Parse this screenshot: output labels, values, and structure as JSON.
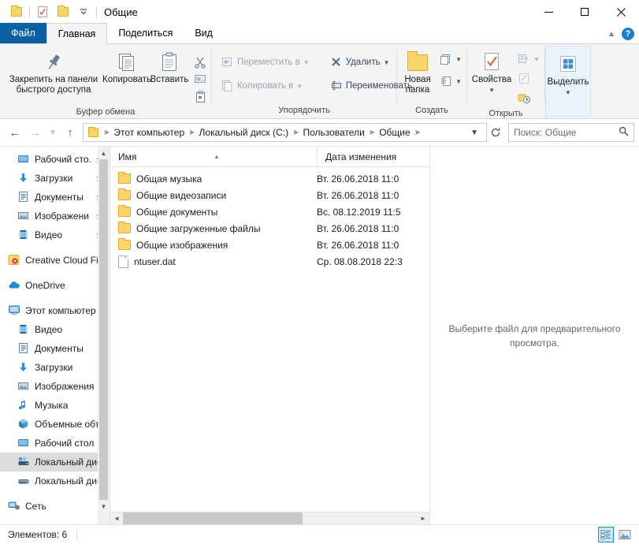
{
  "window": {
    "title": "Общие",
    "quick_access": [
      {
        "name": "folder-icon",
        "label": "Свойства папки"
      },
      {
        "name": "properties-icon",
        "label": "Свойства"
      },
      {
        "name": "new-folder-icon",
        "label": "Новая папка"
      }
    ],
    "controls": {
      "minimize": "Свернуть",
      "maximize": "Развернуть",
      "close": "Закрыть"
    }
  },
  "ribbon": {
    "tabs": [
      {
        "label": "Файл",
        "id": "file",
        "active": false
      },
      {
        "label": "Главная",
        "id": "home",
        "active": true
      },
      {
        "label": "Поделиться",
        "id": "share",
        "active": false
      },
      {
        "label": "Вид",
        "id": "view",
        "active": false
      }
    ],
    "collapse_label": "Свернуть ленту",
    "help_label": "?",
    "groups": [
      {
        "label": "Буфер обмена",
        "big_buttons": [
          {
            "label": "Закрепить на панели быстрого доступа",
            "icon": "pin-icon"
          },
          {
            "label": "Копировать",
            "icon": "copy-icon"
          },
          {
            "label": "Вставить",
            "icon": "paste-icon"
          }
        ],
        "small_buttons": [
          {
            "label": "Вырезать",
            "icon": "scissors-icon"
          },
          {
            "label": "Копировать путь",
            "icon": "copy-path-icon"
          },
          {
            "label": "Вставить ярлык",
            "icon": "paste-shortcut-icon"
          }
        ]
      },
      {
        "label": "Упорядочить",
        "small_buttons": [
          {
            "label": "Переместить в",
            "icon": "move-to-icon",
            "has_caret": true,
            "disabled": true
          },
          {
            "label": "Копировать в",
            "icon": "copy-to-icon",
            "has_caret": true,
            "disabled": true
          },
          {
            "label": "Удалить",
            "icon": "delete-icon",
            "has_caret": true,
            "disabled": false
          },
          {
            "label": "Переименовать",
            "icon": "rename-icon",
            "has_caret": false,
            "disabled": false
          }
        ]
      },
      {
        "label": "Создать",
        "big_buttons": [
          {
            "label": "Новая папка",
            "icon": "new-folder-icon"
          }
        ],
        "small_buttons": [
          {
            "label": "Новый элемент",
            "icon": "new-item-icon",
            "has_caret": true
          },
          {
            "label": "Простой доступ",
            "icon": "easy-access-icon",
            "has_caret": true
          }
        ]
      },
      {
        "label": "Открыть",
        "big_buttons": [
          {
            "label": "Свойства",
            "icon": "properties-icon",
            "has_caret": true
          }
        ],
        "small_buttons": [
          {
            "label": "Открыть",
            "icon": "open-icon",
            "has_caret": true,
            "disabled": true
          },
          {
            "label": "Изменить",
            "icon": "edit-icon",
            "disabled": true
          },
          {
            "label": "Журнал",
            "icon": "history-icon",
            "disabled": false
          }
        ]
      },
      {
        "label": "",
        "big_buttons": [
          {
            "label": "Выделить",
            "icon": "select-icon",
            "has_caret": true,
            "highlighted": true
          }
        ]
      }
    ]
  },
  "address": {
    "back_label": "Назад",
    "forward_label": "Вперёд",
    "recent_label": "Последние расположения",
    "up_label": "Вверх",
    "crumbs": [
      "Этот компьютер",
      "Локальный диск (C:)",
      "Пользователи",
      "Общие"
    ],
    "dropdown_label": "Предыдущие расположения",
    "refresh_label": "Обновить",
    "search_placeholder": "Поиск: Общие",
    "search_value": ""
  },
  "navpane": {
    "items": [
      {
        "label": "Рабочий сто.",
        "icon": "desktop-icon",
        "pinned": true,
        "indent": 1,
        "selected": false
      },
      {
        "label": "Загрузки",
        "icon": "downloads-icon",
        "pinned": true,
        "indent": 1,
        "selected": false
      },
      {
        "label": "Документы",
        "icon": "documents-icon",
        "pinned": true,
        "indent": 1,
        "selected": false
      },
      {
        "label": "Изображени",
        "icon": "pictures-icon",
        "pinned": true,
        "indent": 1,
        "selected": false
      },
      {
        "label": "Видео",
        "icon": "videos-icon",
        "pinned": true,
        "indent": 1,
        "selected": false
      },
      {
        "label": "Creative Cloud Fil",
        "icon": "creative-cloud-icon",
        "pinned": false,
        "indent": 0,
        "selected": false,
        "gap_before": true
      },
      {
        "label": "OneDrive",
        "icon": "onedrive-icon",
        "pinned": false,
        "indent": 0,
        "selected": false,
        "gap_before": true
      },
      {
        "label": "Этот компьютер",
        "icon": "this-pc-icon",
        "pinned": false,
        "indent": 0,
        "selected": false,
        "gap_before": true
      },
      {
        "label": "Видео",
        "icon": "videos-icon",
        "pinned": false,
        "indent": 1,
        "selected": false
      },
      {
        "label": "Документы",
        "icon": "documents-icon",
        "pinned": false,
        "indent": 1,
        "selected": false
      },
      {
        "label": "Загрузки",
        "icon": "downloads-icon",
        "pinned": false,
        "indent": 1,
        "selected": false
      },
      {
        "label": "Изображения",
        "icon": "pictures-icon",
        "pinned": false,
        "indent": 1,
        "selected": false
      },
      {
        "label": "Музыка",
        "icon": "music-icon",
        "pinned": false,
        "indent": 1,
        "selected": false
      },
      {
        "label": "Объемные объ",
        "icon": "3d-objects-icon",
        "pinned": false,
        "indent": 1,
        "selected": false
      },
      {
        "label": "Рабочий стол",
        "icon": "desktop-icon",
        "pinned": false,
        "indent": 1,
        "selected": false
      },
      {
        "label": "Локальный дис",
        "icon": "local-disk-c-icon",
        "pinned": false,
        "indent": 1,
        "selected": true
      },
      {
        "label": "Локальный дис",
        "icon": "local-disk-icon",
        "pinned": false,
        "indent": 1,
        "selected": false
      },
      {
        "label": "Сеть",
        "icon": "network-icon",
        "pinned": false,
        "indent": 0,
        "selected": false,
        "gap_before": true
      }
    ]
  },
  "filelist": {
    "columns": [
      {
        "label": "Имя",
        "key": "name",
        "sorted": true
      },
      {
        "label": "Дата изменения",
        "key": "date",
        "sorted": false
      }
    ],
    "rows": [
      {
        "name": "Общая музыка",
        "date": "Вт. 26.06.2018 11:0",
        "icon": "folder-icon"
      },
      {
        "name": "Общие видеозаписи",
        "date": "Вт. 26.06.2018 11:0",
        "icon": "folder-icon"
      },
      {
        "name": "Общие документы",
        "date": "Вс. 08.12.2019 11:5",
        "icon": "folder-icon"
      },
      {
        "name": "Общие загруженные файлы",
        "date": "Вт. 26.06.2018 11:0",
        "icon": "folder-icon"
      },
      {
        "name": "Общие изображения",
        "date": "Вт. 26.06.2018 11:0",
        "icon": "folder-icon"
      },
      {
        "name": "ntuser.dat",
        "date": "Ср. 08.08.2018 22:3",
        "icon": "file-icon"
      }
    ]
  },
  "preview": {
    "message": "Выберите файл для предварительного просмотра."
  },
  "statusbar": {
    "item_count": "Элементов: 6",
    "views": [
      {
        "name": "details-view",
        "label": "Таблица",
        "active": true
      },
      {
        "name": "large-icons-view",
        "label": "Крупные значки",
        "active": false
      }
    ]
  },
  "colors": {
    "accent": "#0b5fa5",
    "folder": "#fcd568",
    "selection": "#dcdcdc",
    "highlight": "#cce8f7",
    "ribbon_bg": "#f4f4f4"
  }
}
